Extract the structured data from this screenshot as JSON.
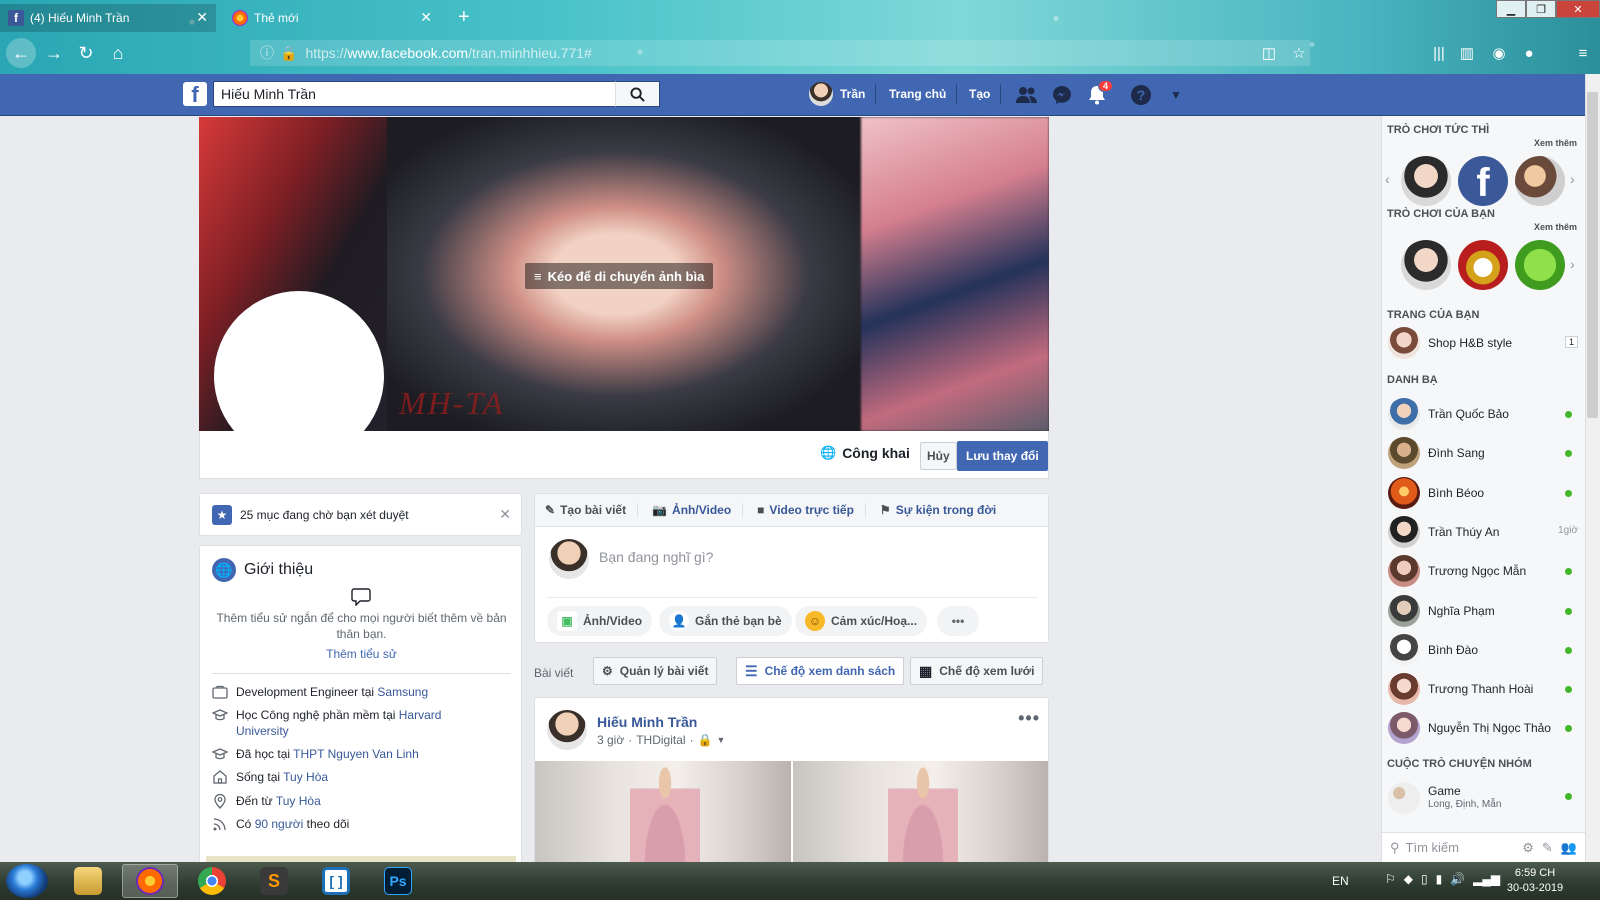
{
  "browser": {
    "tabs": [
      {
        "title": "(4) Hiếu Minh Trần",
        "icon": "facebook-icon"
      },
      {
        "title": "Thẻ mới",
        "icon": "firefox-icon"
      }
    ],
    "url_scheme": "https://",
    "url_host": "www.facebook.com",
    "url_path": "/tran.minhhieu.771#"
  },
  "fb_header": {
    "search_value": "Hiếu Minh Trần",
    "profile_name": "Trần",
    "home_label": "Trang chủ",
    "create_label": "Tạo",
    "notification_count": "4"
  },
  "cover": {
    "drag_hint": "Kéo để di chuyển ảnh bìa",
    "watermark": "MH-TA",
    "privacy_label": "Công khai",
    "cancel_label": "Hủy",
    "save_label": "Lưu thay đổi"
  },
  "pending": {
    "text": "25 mục đang chờ bạn xét duyệt"
  },
  "intro": {
    "title": "Giới thiệu",
    "bio_prompt": "Thêm tiểu sử ngắn để cho mọi người biết thêm về bản thân bạn.",
    "bio_link": "Thêm tiểu sử",
    "items": [
      {
        "prefix": "Development Engineer tại ",
        "link": "Samsung",
        "icon": "briefcase-icon"
      },
      {
        "prefix": "Học Công nghệ phần mềm tại ",
        "link": "Harvard University",
        "icon": "graduation-cap-icon"
      },
      {
        "prefix": "Đã học tại ",
        "link": "THPT Nguyen Van Linh",
        "icon": "graduation-cap-icon"
      },
      {
        "prefix": "Sống tại ",
        "link": "Tuy Hòa",
        "icon": "home-icon"
      },
      {
        "prefix": "Đến từ ",
        "link": "Tuy Hòa",
        "icon": "location-pin-icon"
      },
      {
        "prefix": "Có ",
        "link": "90 người",
        "suffix": " theo dõi",
        "icon": "rss-icon"
      }
    ]
  },
  "composer": {
    "tabs": [
      "Tạo bài viết",
      "Ảnh/Video",
      "Video trực tiếp",
      "Sự kiện trong đời"
    ],
    "placeholder": "Bạn đang nghĩ gì?",
    "actions": [
      "Ảnh/Video",
      "Gắn thẻ bạn bè",
      "Cảm xúc/Hoạ..."
    ]
  },
  "posts_toolbar": {
    "label": "Bài viết",
    "manage": "Quản lý bài viết",
    "list_view": "Chế độ xem danh sách",
    "grid_view": "Chế độ xem lưới"
  },
  "post": {
    "author": "Hiếu Minh Trần",
    "time": "3 giờ",
    "via": "THDigital"
  },
  "sidebar": {
    "instant_games": "Trò chơi tức thì",
    "your_games": "Trò chơi của bạn",
    "see_more": "Xem thêm",
    "your_pages": "Trang của bạn",
    "page_name": "Shop H&B style",
    "page_count": "1",
    "contacts_title": "Danh bạ",
    "contacts": [
      {
        "name": "Trần Quốc Bảo",
        "status": "online"
      },
      {
        "name": "Đình Sang",
        "status": "online"
      },
      {
        "name": "Bình Béoo",
        "status": "online"
      },
      {
        "name": "Trần Thúy An",
        "status": "1giờ"
      },
      {
        "name": "Trương Ngọc Mẫn",
        "status": "online"
      },
      {
        "name": "Nghĩa Phạm",
        "status": "online"
      },
      {
        "name": "Bình Đào",
        "status": "online"
      },
      {
        "name": "Trương Thanh Hoài",
        "status": "online"
      },
      {
        "name": "Nguyễn Thị Ngọc Thảo",
        "status": "online"
      }
    ],
    "group_chats_title": "Cuộc trò chuyện nhóm",
    "group_name": "Game",
    "group_members": "Long, Định, Mẫn",
    "search_placeholder": "Tìm kiếm"
  },
  "taskbar": {
    "apps": [
      "explorer-icon",
      "firefox-icon",
      "chrome-icon",
      "sublime-icon",
      "bracket-app-icon",
      "photoshop-icon"
    ],
    "language": "EN",
    "time": "6:59 CH",
    "date": "30-03-2019"
  },
  "colors": {
    "fb_blue": "#4267b2",
    "link": "#385898",
    "online": "#42b72a",
    "notif": "#fa3e3e"
  }
}
